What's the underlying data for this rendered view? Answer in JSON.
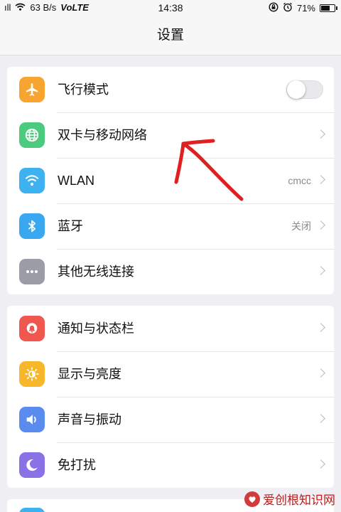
{
  "status_bar": {
    "signal": "ıll",
    "speed": "63 B/s",
    "network": "VoLTE",
    "time": "14:38",
    "battery": "71%",
    "battery_level": 0.71
  },
  "header": {
    "title": "设置"
  },
  "groups": [
    {
      "items": [
        {
          "label": "飞行模式",
          "icon": "airplane-icon",
          "color": "#f7a431",
          "toggle": false
        },
        {
          "label": "双卡与移动网络",
          "icon": "globe-icon",
          "color": "#4ccb7f"
        },
        {
          "label": "WLAN",
          "value": "cmcc",
          "icon": "wifi-icon",
          "color": "#3eb1f1"
        },
        {
          "label": "蓝牙",
          "value": "关闭",
          "icon": "bluetooth-icon",
          "color": "#39a8f0"
        },
        {
          "label": "其他无线连接",
          "icon": "more-icon",
          "color": "#9a9ca6"
        }
      ]
    },
    {
      "items": [
        {
          "label": "通知与状态栏",
          "icon": "notification-icon",
          "color": "#f0574e"
        },
        {
          "label": "显示与亮度",
          "icon": "brightness-icon",
          "color": "#f8b62b"
        },
        {
          "label": "声音与振动",
          "icon": "sound-icon",
          "color": "#5a8cf0"
        },
        {
          "label": "免打扰",
          "icon": "moon-icon",
          "color": "#8a72e6"
        }
      ]
    }
  ],
  "annotation": {
    "type": "hand-drawn-arrow",
    "color": "#e02020",
    "points_to": "双卡与移动网络"
  },
  "watermark": {
    "text": "爱创根知识网"
  }
}
